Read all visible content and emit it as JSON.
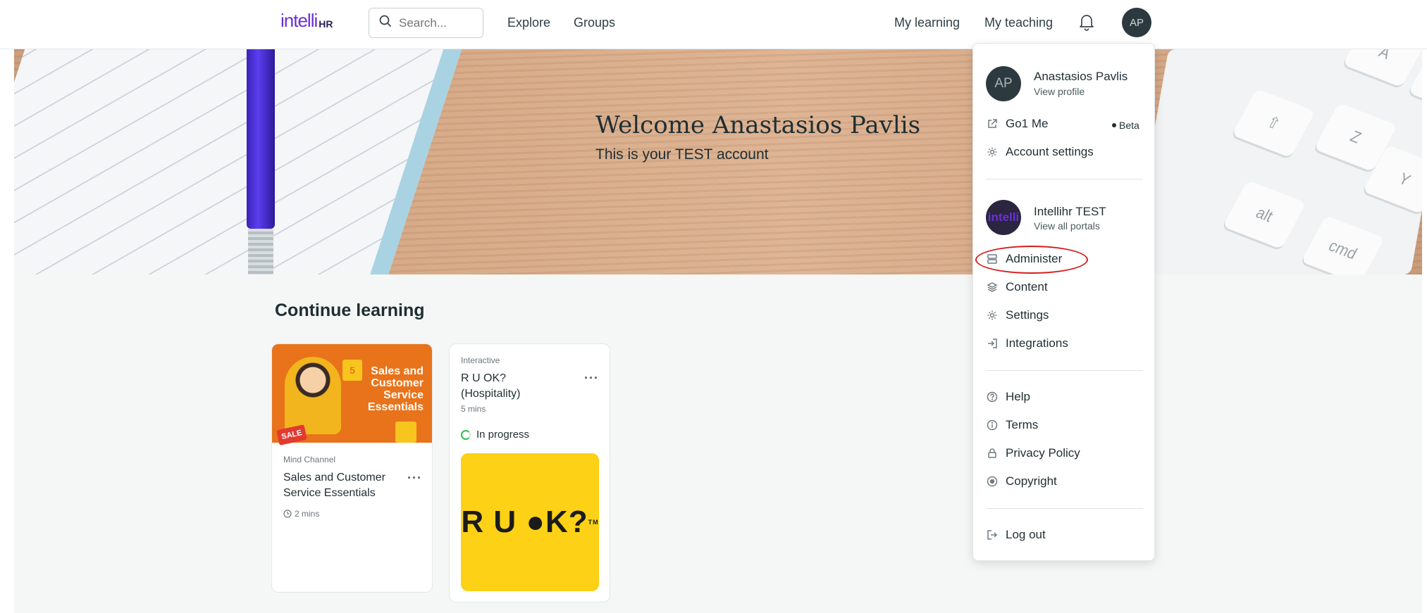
{
  "nav": {
    "logo_main": "intelli",
    "logo_suffix": "HR",
    "search_placeholder": "Search...",
    "explore": "Explore",
    "groups": "Groups",
    "my_learning": "My learning",
    "my_teaching": "My teaching",
    "avatar_initials": "AP"
  },
  "hero": {
    "title": "Welcome Anastasios Pavlis",
    "subtitle": "This is your TEST account"
  },
  "continue_learning": {
    "title": "Continue learning",
    "cards": [
      {
        "thumbnail_text": [
          "Sales and",
          "Customer",
          "Service",
          "Essentials"
        ],
        "source": "Mind Channel",
        "title": "Sales and Customer Service Essentials",
        "duration": "2 mins"
      },
      {
        "source": "Interactive",
        "title": "R U OK? (Hospitality)",
        "duration": "5 mins",
        "status": "In progress",
        "thumbnail_text": "R U ●K?",
        "thumbnail_tm": "TM"
      }
    ]
  },
  "dropdown": {
    "user_initials": "AP",
    "user_name": "Anastasios Pavlis",
    "view_profile": "View profile",
    "go1_me": "Go1 Me",
    "beta": "Beta",
    "account_settings": "Account settings",
    "portal_logo": "intelli",
    "portal_name": "Intellihr TEST",
    "view_all_portals": "View all portals",
    "administer": "Administer",
    "content": "Content",
    "settings": "Settings",
    "integrations": "Integrations",
    "help": "Help",
    "terms": "Terms",
    "privacy_policy": "Privacy Policy",
    "copyright": "Copyright",
    "log_out": "Log out"
  },
  "colors": {
    "brand_purple": "#6b2fd6",
    "avatar_bg": "#2c3a3f",
    "highlight_red": "#d61d1d",
    "progress_green": "#2fbf4a",
    "ruok_yellow": "#fcd116"
  }
}
